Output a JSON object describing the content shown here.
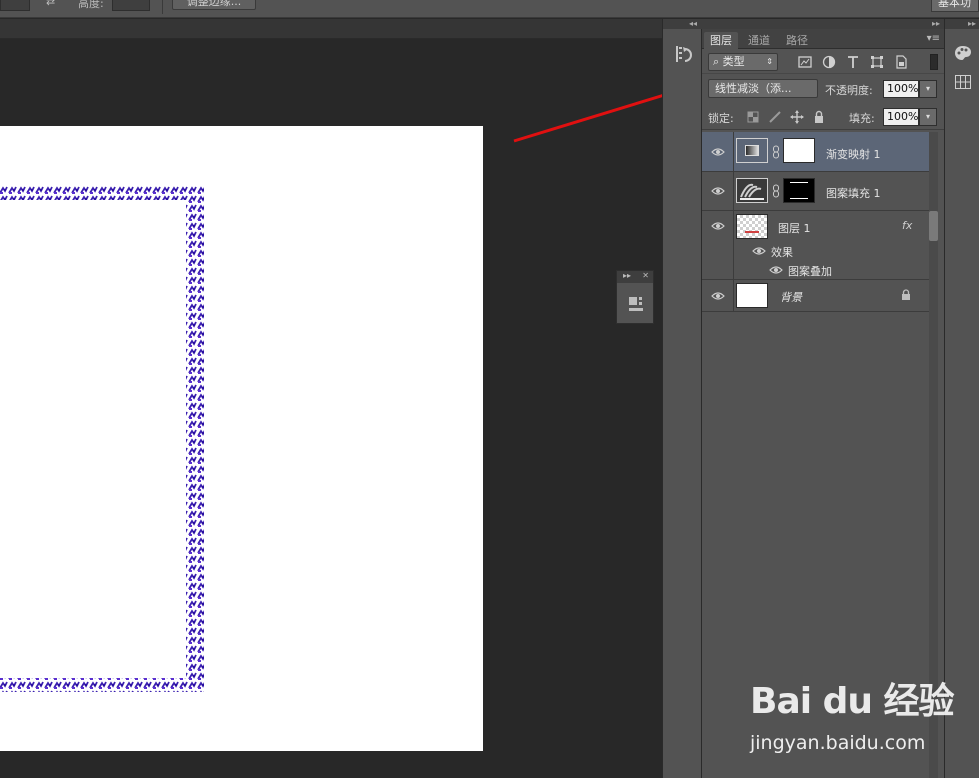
{
  "options_bar": {
    "height_label": "高度:",
    "refine_edge_button": "调整边缘...",
    "workspace_label": "基本功"
  },
  "layers_panel": {
    "tabs": [
      {
        "label": "图层",
        "active": true
      },
      {
        "label": "通道",
        "active": false
      },
      {
        "label": "路径",
        "active": false
      }
    ],
    "filter_kind": "类型",
    "filter_icons": [
      "pixel-filter-icon",
      "adjustment-filter-icon",
      "type-filter-icon",
      "shape-filter-icon",
      "smart-object-filter-icon"
    ],
    "blend_mode": "线性减淡（添...",
    "opacity_label": "不透明度:",
    "opacity_value": "100%",
    "lock_label": "锁定:",
    "fill_label": "填充:",
    "fill_value": "100%",
    "layers": [
      {
        "name": "渐变映射 1",
        "type": "adjustment",
        "selected": true
      },
      {
        "name": "图案填充 1",
        "type": "pattern-fill",
        "selected": false
      },
      {
        "name": "图层 1",
        "type": "pixel",
        "selected": false,
        "fx": "fx",
        "effects_label": "效果",
        "effects": [
          "图案叠加"
        ]
      },
      {
        "name": "背景",
        "type": "background",
        "selected": false
      }
    ]
  },
  "colors": {
    "panel_bg": "#535353",
    "canvas_bg": "#282828",
    "selected_row": "#5c6677",
    "annotation_arrow": "#e01010",
    "pattern_purple": "#3a1fb0"
  },
  "watermark": {
    "brand": "Bai du 经验",
    "url": "jingyan.baidu.com"
  }
}
